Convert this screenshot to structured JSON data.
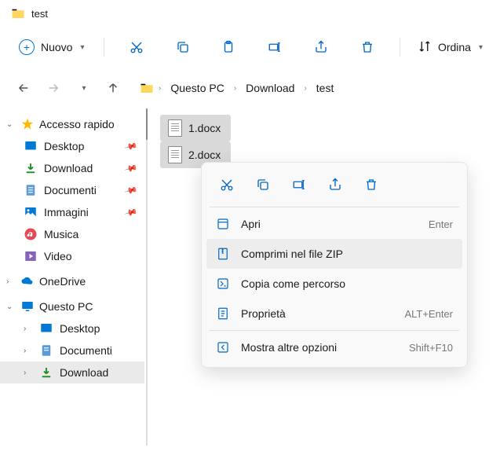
{
  "window": {
    "title": "test"
  },
  "toolbar": {
    "new_label": "Nuovo",
    "sort_label": "Ordina"
  },
  "breadcrumb": {
    "items": [
      "Questo PC",
      "Download",
      "test"
    ]
  },
  "sidebar": {
    "quick_access": {
      "label": "Accesso rapido",
      "items": [
        {
          "label": "Desktop",
          "pinned": true,
          "icon": "desktop"
        },
        {
          "label": "Download",
          "pinned": true,
          "icon": "download"
        },
        {
          "label": "Documenti",
          "pinned": true,
          "icon": "document"
        },
        {
          "label": "Immagini",
          "pinned": true,
          "icon": "images"
        },
        {
          "label": "Musica",
          "pinned": false,
          "icon": "music"
        },
        {
          "label": "Video",
          "pinned": false,
          "icon": "video"
        }
      ]
    },
    "onedrive": {
      "label": "OneDrive"
    },
    "this_pc": {
      "label": "Questo PC",
      "items": [
        {
          "label": "Desktop",
          "icon": "desktop"
        },
        {
          "label": "Documenti",
          "icon": "document"
        },
        {
          "label": "Download",
          "icon": "download",
          "selected": true
        }
      ]
    }
  },
  "files": [
    {
      "name": "1.docx",
      "selected": true
    },
    {
      "name": "2.docx",
      "selected": true
    }
  ],
  "context_menu": {
    "items": [
      {
        "label": "Apri",
        "shortcut": "Enter",
        "icon": "open"
      },
      {
        "label": "Comprimi nel file ZIP",
        "shortcut": "",
        "icon": "zip",
        "hover": true
      },
      {
        "label": "Copia come percorso",
        "shortcut": "",
        "icon": "path"
      },
      {
        "label": "Proprietà",
        "shortcut": "ALT+Enter",
        "icon": "props"
      },
      {
        "label": "Mostra altre opzioni",
        "shortcut": "Shift+F10",
        "icon": "more",
        "separated": true
      }
    ]
  }
}
